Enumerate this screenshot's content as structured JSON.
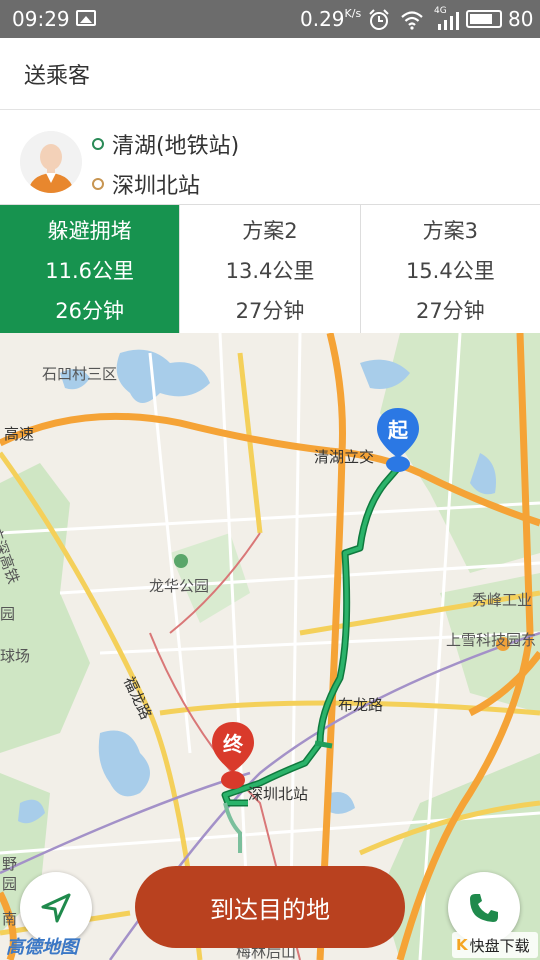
{
  "status_bar": {
    "time": "09:29",
    "speed": "0.29",
    "speed_unit": "K/s",
    "network": "4G",
    "battery": "80"
  },
  "header": {
    "title": "送乘客"
  },
  "passenger": {
    "from": "清湖(地铁站)",
    "to": "深圳北站"
  },
  "plans": [
    {
      "name": "躲避拥堵",
      "distance": "11.6公里",
      "duration": "26分钟",
      "selected": true
    },
    {
      "name": "方案2",
      "distance": "13.4公里",
      "duration": "27分钟",
      "selected": false
    },
    {
      "name": "方案3",
      "distance": "15.4公里",
      "duration": "27分钟",
      "selected": false
    }
  ],
  "map": {
    "labels": {
      "village": "石凹村三区",
      "expressway_left": "高速",
      "qinghu_interchange": "清湖立交",
      "longhua_park": "龙华公园",
      "guangshen_railway": "广深高铁",
      "fulong_road": "福龙路",
      "bulong_road": "布龙路",
      "shenzhen_north": "深圳北站",
      "xiufeng": "秀峰工业",
      "shangxue": "上雪科技园东",
      "meilin": "梅林后山",
      "park_left": "园",
      "field_left": "球场",
      "wild_left": "野",
      "garden_left": "园",
      "south_left": "南"
    },
    "start_marker": "起",
    "end_marker": "终",
    "logo": "高德地图"
  },
  "actions": {
    "arrive": "到达目的地"
  },
  "watermark": {
    "k": "K",
    "text": "快盘下载"
  },
  "colors": {
    "accent_green": "#17934f",
    "arrive_button": "#b9411f",
    "route_green": "#1f9e5a",
    "start_blue": "#2b78e4",
    "end_red": "#d93a2b"
  }
}
